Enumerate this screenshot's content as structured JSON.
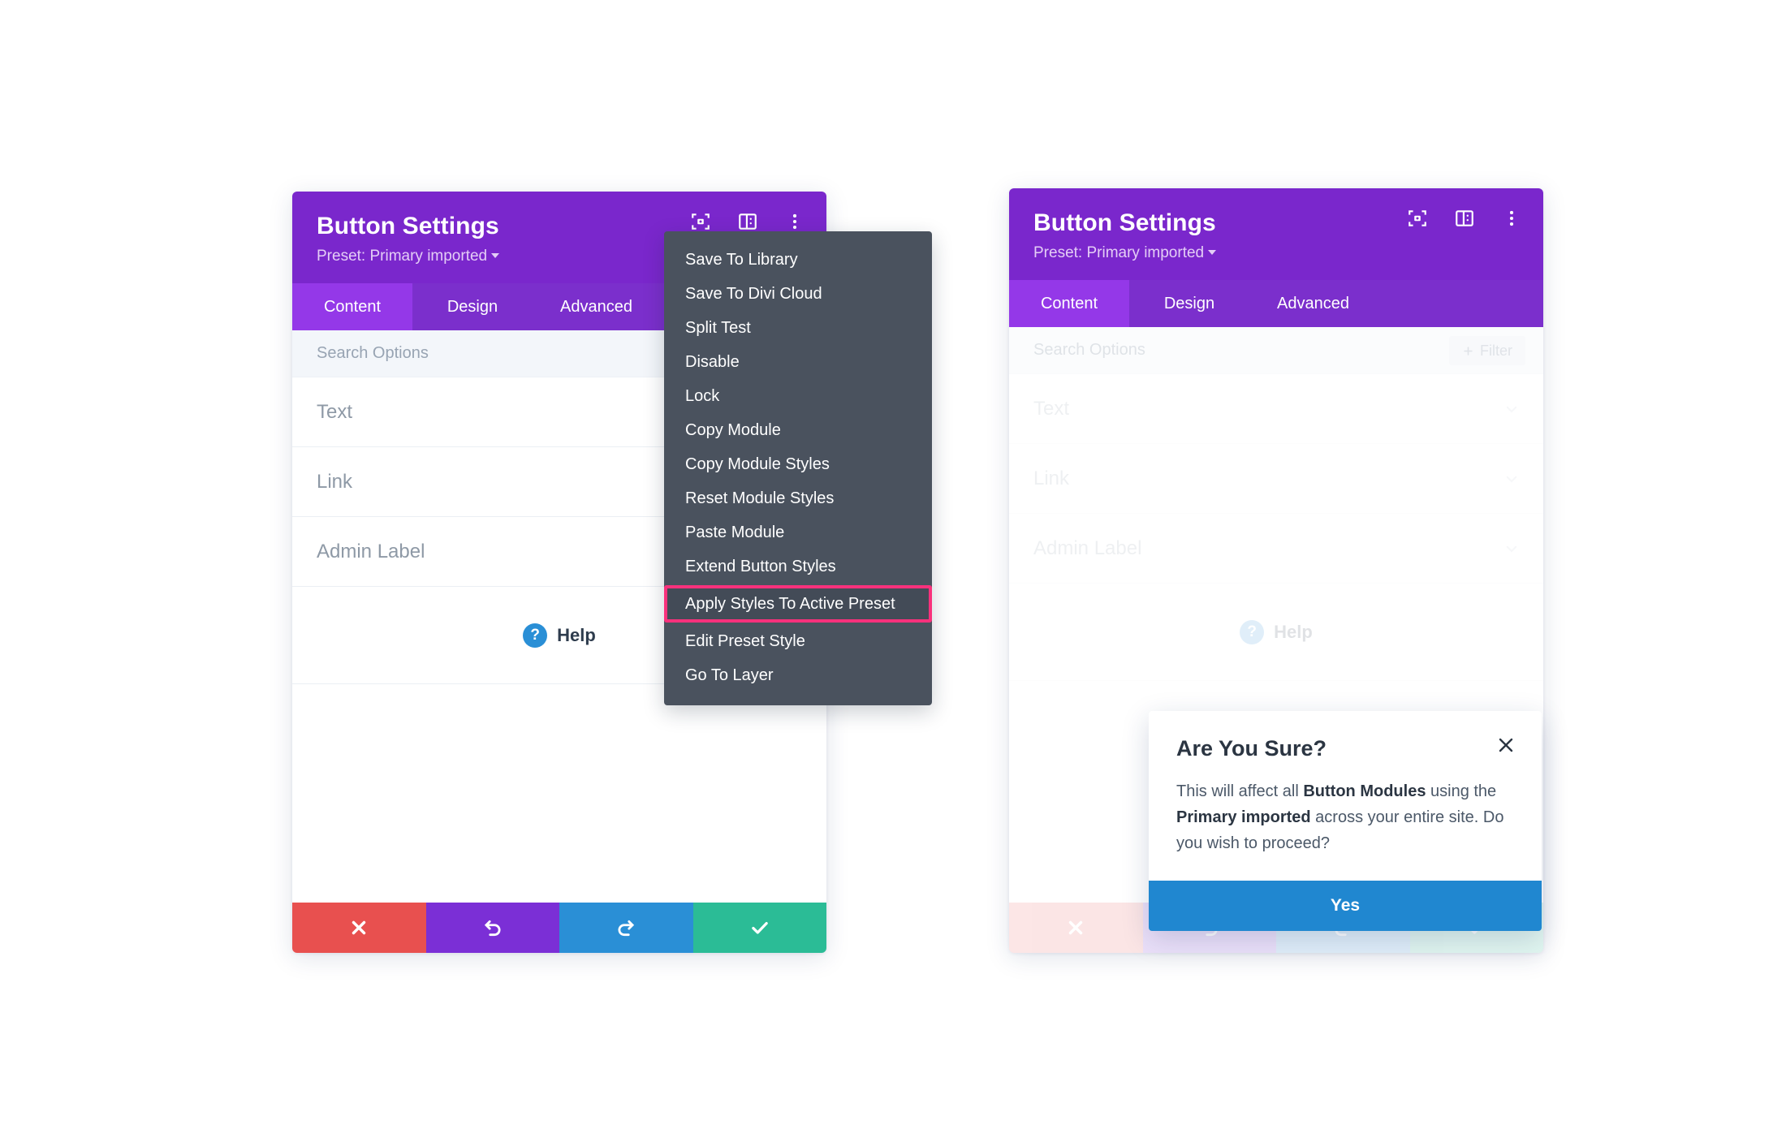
{
  "panels": {
    "left": {
      "title": "Button Settings",
      "preset": "Preset: Primary imported",
      "header_icons": [
        "focus-frame-icon",
        "layout-panel-icon",
        "three-dot-menu-icon"
      ],
      "tabs": [
        {
          "label": "Content",
          "active": true
        },
        {
          "label": "Design",
          "active": false
        },
        {
          "label": "Advanced",
          "active": false
        }
      ],
      "search_placeholder": "Search Options",
      "sections": [
        {
          "label": "Text"
        },
        {
          "label": "Link"
        },
        {
          "label": "Admin Label"
        }
      ],
      "help": {
        "badge": "?",
        "label": "Help"
      },
      "actions": [
        {
          "name": "cancel-button",
          "icon": "close-icon",
          "color": "#E8504F"
        },
        {
          "name": "undo-button",
          "icon": "undo-icon",
          "color": "#7B2FD6"
        },
        {
          "name": "redo-button",
          "icon": "redo-icon",
          "color": "#2A8FD6"
        },
        {
          "name": "save-button",
          "icon": "check-icon",
          "color": "#2BBC96"
        }
      ]
    },
    "right": {
      "title": "Button Settings",
      "preset": "Preset: Primary imported",
      "tabs": [
        {
          "label": "Content",
          "active": true
        },
        {
          "label": "Design",
          "active": false
        },
        {
          "label": "Advanced",
          "active": false
        }
      ],
      "search_placeholder": "Search Options",
      "filter_label": "Filter",
      "sections": [
        {
          "label": "Text"
        },
        {
          "label": "Link"
        },
        {
          "label": "Admin Label"
        }
      ],
      "help": {
        "badge": "?",
        "label": "Help"
      }
    }
  },
  "dropdown": {
    "items": [
      {
        "label": "Save To Library",
        "highlighted": false
      },
      {
        "label": "Save To Divi Cloud",
        "highlighted": false
      },
      {
        "label": "Split Test",
        "highlighted": false
      },
      {
        "label": "Disable",
        "highlighted": false
      },
      {
        "label": "Lock",
        "highlighted": false
      },
      {
        "label": "Copy Module",
        "highlighted": false
      },
      {
        "label": "Copy Module Styles",
        "highlighted": false
      },
      {
        "label": "Reset Module Styles",
        "highlighted": false
      },
      {
        "label": "Paste Module",
        "highlighted": false
      },
      {
        "label": "Extend Button Styles",
        "highlighted": false
      },
      {
        "label": "Apply Styles To Active Preset",
        "highlighted": true
      },
      {
        "label": "Edit Preset Style",
        "highlighted": false
      },
      {
        "label": "Go To Layer",
        "highlighted": false
      }
    ],
    "highlight_color": "#F9317C"
  },
  "modal": {
    "title": "Are You Sure?",
    "message_part1": "This will affect all ",
    "message_bold1": "Button Modules",
    "message_part2": " using the ",
    "message_bold2": "Primary imported",
    "message_part3": " across your entire site. Do you wish to proceed?",
    "confirm_label": "Yes",
    "close_icon": "close-icon"
  },
  "colors": {
    "header_purple": "#7A27CC",
    "tab_bar_purple": "#7B2FCC",
    "tab_active_purple": "#9438E8",
    "menu_dark": "#4A525E",
    "highlight_pink": "#F9317C",
    "confirm_blue": "#2087D0"
  }
}
